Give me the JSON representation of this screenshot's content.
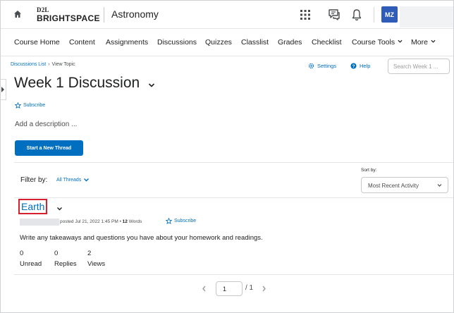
{
  "header": {
    "logo_small": "D2L",
    "logo_brand": "BRIGHTSPACE",
    "course_title": "Astronomy",
    "avatar_initials": "MZ",
    "icons": [
      "home-icon",
      "apps-grid-icon",
      "chat-icon",
      "bell-icon"
    ]
  },
  "nav": {
    "items": [
      "Course Home",
      "Content",
      "Assignments",
      "Discussions",
      "Quizzes",
      "Classlist",
      "Grades",
      "Checklist",
      "Course Tools",
      "More"
    ]
  },
  "breadcrumb": {
    "parent": "Discussions List",
    "current": "View Topic"
  },
  "toolbar": {
    "settings": "Settings",
    "help": "Help",
    "search_placeholder": "Search Week 1 ..."
  },
  "topic": {
    "title": "Week 1 Discussion",
    "subscribe": "Subscribe",
    "description_prompt": "Add a description ...",
    "new_thread_button": "Start a New Thread"
  },
  "filters": {
    "filter_label": "Filter by:",
    "filter_value": "All Threads",
    "sort_label": "Sort by:",
    "sort_value": "Most Recent Activity"
  },
  "thread": {
    "title": "Earth",
    "posted": "posted Jul 21, 2022 1:45 PM",
    "bullet": "•",
    "word_count": "12",
    "word_label": "Words",
    "subscribe": "Subscribe",
    "body": "Write any takeaways and questions you have about your homework and readings.",
    "stats": [
      {
        "value": "0",
        "label": "Unread"
      },
      {
        "value": "0",
        "label": "Replies"
      },
      {
        "value": "2",
        "label": "Views"
      }
    ]
  },
  "pager": {
    "current": "1",
    "total": "/ 1"
  },
  "colors": {
    "accent": "#006fbf",
    "highlight": "#d6202f",
    "avatar": "#2e5cb8"
  }
}
